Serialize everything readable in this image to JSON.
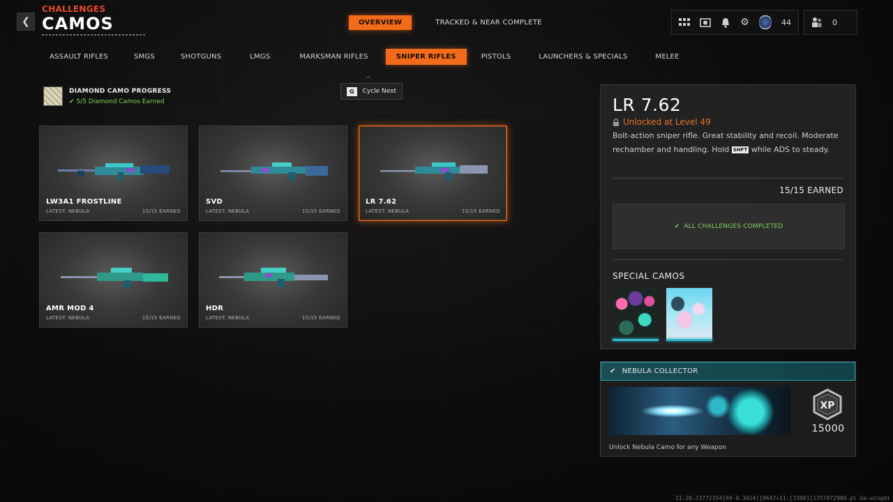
{
  "header": {
    "supertitle": "CHALLENGES",
    "title": "CAMOS",
    "tabs": [
      {
        "label": "OVERVIEW",
        "active": true
      },
      {
        "label": "TRACKED & NEAR COMPLETE",
        "active": false
      }
    ],
    "emblem_level": "44",
    "friends_count": "0"
  },
  "categories": [
    {
      "label": "ASSAULT RIFLES",
      "active": false
    },
    {
      "label": "SMGS",
      "active": false
    },
    {
      "label": "SHOTGUNS",
      "active": false
    },
    {
      "label": "LMGS",
      "active": false
    },
    {
      "label": "MARKSMAN RIFLES",
      "active": false
    },
    {
      "label": "SNIPER RIFLES",
      "active": true
    },
    {
      "label": "PISTOLS",
      "active": false
    },
    {
      "label": "LAUNCHERS & SPECIALS",
      "active": false
    },
    {
      "label": "MELEE",
      "active": false
    }
  ],
  "diamond": {
    "title": "DIAMOND CAMO PROGRESS",
    "status": "5/5 Diamond Camos Earned"
  },
  "cycle": {
    "key": "G",
    "label": "Cycle Next"
  },
  "weapons": [
    {
      "name": "LW3A1 FROSTLINE",
      "latest": "LATEST: NEBULA",
      "earned": "15/15 EARNED",
      "selected": false
    },
    {
      "name": "SVD",
      "latest": "LATEST: NEBULA",
      "earned": "15/15 EARNED",
      "selected": false
    },
    {
      "name": "LR 7.62",
      "latest": "LATEST: NEBULA",
      "earned": "15/15 EARNED",
      "selected": true
    },
    {
      "name": "AMR MOD 4",
      "latest": "LATEST: NEBULA",
      "earned": "15/15 EARNED",
      "selected": false
    },
    {
      "name": "HDR",
      "latest": "LATEST: NEBULA",
      "earned": "15/15 EARNED",
      "selected": false
    }
  ],
  "detail": {
    "name": "LR 7.62",
    "unlock": "Unlocked at Level 49",
    "desc_pre": "Bolt-action sniper rifle.  Great stability and recoil. Moderate rechamber and handling.  Hold ",
    "desc_key": "SHFT",
    "desc_post": " while ADS to steady.",
    "earned": "15/15 EARNED",
    "completed": "ALL CHALLENGES COMPLETED",
    "special_title": "SPECIAL CAMOS"
  },
  "nebula": {
    "title": "NEBULA COLLECTOR",
    "xp_label": "XP",
    "xp": "15000",
    "desc": "Unlock Nebula Camo for any Weapon"
  },
  "build": "11.20.23772154[69-0.3424][0647+11:[7300][1757872980.pl.Ga.wingdi"
}
